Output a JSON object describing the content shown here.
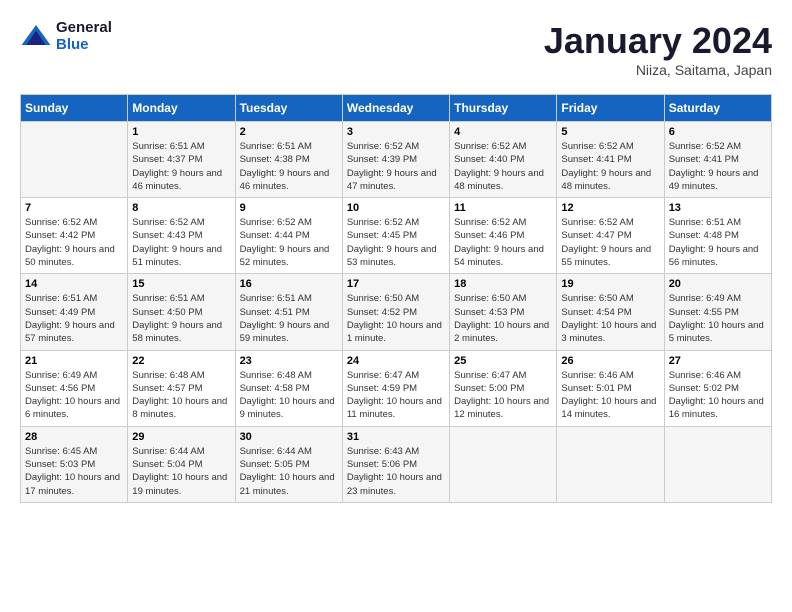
{
  "header": {
    "logo_line1": "General",
    "logo_line2": "Blue",
    "month": "January 2024",
    "location": "Niiza, Saitama, Japan"
  },
  "weekdays": [
    "Sunday",
    "Monday",
    "Tuesday",
    "Wednesday",
    "Thursday",
    "Friday",
    "Saturday"
  ],
  "weeks": [
    [
      {
        "day": "",
        "sunrise": "",
        "sunset": "",
        "daylight": ""
      },
      {
        "day": "1",
        "sunrise": "Sunrise: 6:51 AM",
        "sunset": "Sunset: 4:37 PM",
        "daylight": "Daylight: 9 hours and 46 minutes."
      },
      {
        "day": "2",
        "sunrise": "Sunrise: 6:51 AM",
        "sunset": "Sunset: 4:38 PM",
        "daylight": "Daylight: 9 hours and 46 minutes."
      },
      {
        "day": "3",
        "sunrise": "Sunrise: 6:52 AM",
        "sunset": "Sunset: 4:39 PM",
        "daylight": "Daylight: 9 hours and 47 minutes."
      },
      {
        "day": "4",
        "sunrise": "Sunrise: 6:52 AM",
        "sunset": "Sunset: 4:40 PM",
        "daylight": "Daylight: 9 hours and 48 minutes."
      },
      {
        "day": "5",
        "sunrise": "Sunrise: 6:52 AM",
        "sunset": "Sunset: 4:41 PM",
        "daylight": "Daylight: 9 hours and 48 minutes."
      },
      {
        "day": "6",
        "sunrise": "Sunrise: 6:52 AM",
        "sunset": "Sunset: 4:41 PM",
        "daylight": "Daylight: 9 hours and 49 minutes."
      }
    ],
    [
      {
        "day": "7",
        "sunrise": "Sunrise: 6:52 AM",
        "sunset": "Sunset: 4:42 PM",
        "daylight": "Daylight: 9 hours and 50 minutes."
      },
      {
        "day": "8",
        "sunrise": "Sunrise: 6:52 AM",
        "sunset": "Sunset: 4:43 PM",
        "daylight": "Daylight: 9 hours and 51 minutes."
      },
      {
        "day": "9",
        "sunrise": "Sunrise: 6:52 AM",
        "sunset": "Sunset: 4:44 PM",
        "daylight": "Daylight: 9 hours and 52 minutes."
      },
      {
        "day": "10",
        "sunrise": "Sunrise: 6:52 AM",
        "sunset": "Sunset: 4:45 PM",
        "daylight": "Daylight: 9 hours and 53 minutes."
      },
      {
        "day": "11",
        "sunrise": "Sunrise: 6:52 AM",
        "sunset": "Sunset: 4:46 PM",
        "daylight": "Daylight: 9 hours and 54 minutes."
      },
      {
        "day": "12",
        "sunrise": "Sunrise: 6:52 AM",
        "sunset": "Sunset: 4:47 PM",
        "daylight": "Daylight: 9 hours and 55 minutes."
      },
      {
        "day": "13",
        "sunrise": "Sunrise: 6:51 AM",
        "sunset": "Sunset: 4:48 PM",
        "daylight": "Daylight: 9 hours and 56 minutes."
      }
    ],
    [
      {
        "day": "14",
        "sunrise": "Sunrise: 6:51 AM",
        "sunset": "Sunset: 4:49 PM",
        "daylight": "Daylight: 9 hours and 57 minutes."
      },
      {
        "day": "15",
        "sunrise": "Sunrise: 6:51 AM",
        "sunset": "Sunset: 4:50 PM",
        "daylight": "Daylight: 9 hours and 58 minutes."
      },
      {
        "day": "16",
        "sunrise": "Sunrise: 6:51 AM",
        "sunset": "Sunset: 4:51 PM",
        "daylight": "Daylight: 9 hours and 59 minutes."
      },
      {
        "day": "17",
        "sunrise": "Sunrise: 6:50 AM",
        "sunset": "Sunset: 4:52 PM",
        "daylight": "Daylight: 10 hours and 1 minute."
      },
      {
        "day": "18",
        "sunrise": "Sunrise: 6:50 AM",
        "sunset": "Sunset: 4:53 PM",
        "daylight": "Daylight: 10 hours and 2 minutes."
      },
      {
        "day": "19",
        "sunrise": "Sunrise: 6:50 AM",
        "sunset": "Sunset: 4:54 PM",
        "daylight": "Daylight: 10 hours and 3 minutes."
      },
      {
        "day": "20",
        "sunrise": "Sunrise: 6:49 AM",
        "sunset": "Sunset: 4:55 PM",
        "daylight": "Daylight: 10 hours and 5 minutes."
      }
    ],
    [
      {
        "day": "21",
        "sunrise": "Sunrise: 6:49 AM",
        "sunset": "Sunset: 4:56 PM",
        "daylight": "Daylight: 10 hours and 6 minutes."
      },
      {
        "day": "22",
        "sunrise": "Sunrise: 6:48 AM",
        "sunset": "Sunset: 4:57 PM",
        "daylight": "Daylight: 10 hours and 8 minutes."
      },
      {
        "day": "23",
        "sunrise": "Sunrise: 6:48 AM",
        "sunset": "Sunset: 4:58 PM",
        "daylight": "Daylight: 10 hours and 9 minutes."
      },
      {
        "day": "24",
        "sunrise": "Sunrise: 6:47 AM",
        "sunset": "Sunset: 4:59 PM",
        "daylight": "Daylight: 10 hours and 11 minutes."
      },
      {
        "day": "25",
        "sunrise": "Sunrise: 6:47 AM",
        "sunset": "Sunset: 5:00 PM",
        "daylight": "Daylight: 10 hours and 12 minutes."
      },
      {
        "day": "26",
        "sunrise": "Sunrise: 6:46 AM",
        "sunset": "Sunset: 5:01 PM",
        "daylight": "Daylight: 10 hours and 14 minutes."
      },
      {
        "day": "27",
        "sunrise": "Sunrise: 6:46 AM",
        "sunset": "Sunset: 5:02 PM",
        "daylight": "Daylight: 10 hours and 16 minutes."
      }
    ],
    [
      {
        "day": "28",
        "sunrise": "Sunrise: 6:45 AM",
        "sunset": "Sunset: 5:03 PM",
        "daylight": "Daylight: 10 hours and 17 minutes."
      },
      {
        "day": "29",
        "sunrise": "Sunrise: 6:44 AM",
        "sunset": "Sunset: 5:04 PM",
        "daylight": "Daylight: 10 hours and 19 minutes."
      },
      {
        "day": "30",
        "sunrise": "Sunrise: 6:44 AM",
        "sunset": "Sunset: 5:05 PM",
        "daylight": "Daylight: 10 hours and 21 minutes."
      },
      {
        "day": "31",
        "sunrise": "Sunrise: 6:43 AM",
        "sunset": "Sunset: 5:06 PM",
        "daylight": "Daylight: 10 hours and 23 minutes."
      },
      {
        "day": "",
        "sunrise": "",
        "sunset": "",
        "daylight": ""
      },
      {
        "day": "",
        "sunrise": "",
        "sunset": "",
        "daylight": ""
      },
      {
        "day": "",
        "sunrise": "",
        "sunset": "",
        "daylight": ""
      }
    ]
  ]
}
